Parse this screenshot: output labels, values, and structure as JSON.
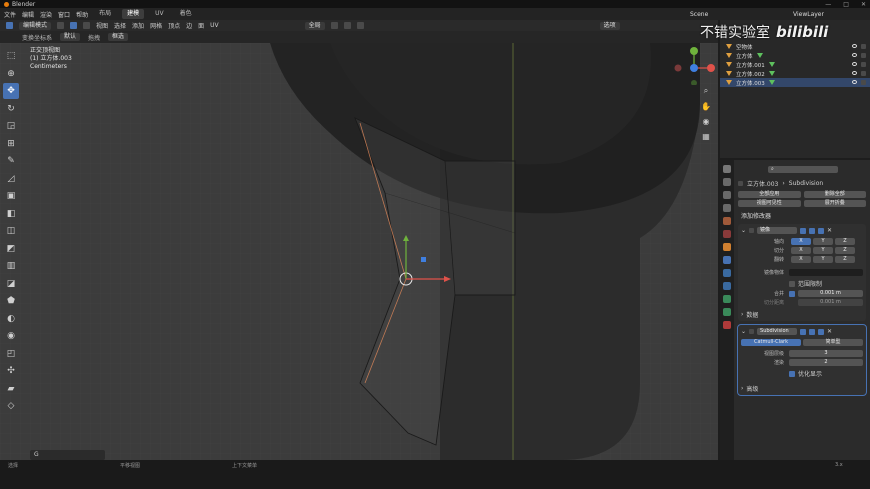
{
  "titlebar": {
    "title": "Blender",
    "controls": [
      "—",
      "□",
      "✕"
    ]
  },
  "menubar": {
    "menus": [
      "文件",
      "编辑",
      "渲染",
      "窗口",
      "帮助"
    ],
    "tabs": [
      "布局",
      "建模",
      "UV",
      "着色"
    ],
    "active_tab": "建模",
    "scene_label": "Scene",
    "viewlayer_label": "ViewLayer"
  },
  "header": {
    "mode": "编辑模式",
    "menus": [
      "视图",
      "选择",
      "添加",
      "网格",
      "顶点",
      "边",
      "面",
      "UV"
    ],
    "transform_orient": "全局",
    "tool_options": [
      "选项"
    ]
  },
  "tooloptions": {
    "orient_label": "变换坐标系",
    "orient_value": "默认",
    "drag_label": "拖拽",
    "drag_value": "框选"
  },
  "viewport": {
    "view_name": "正交顶视图",
    "object_name": "(1) 立方体.003",
    "units": "Centimeters",
    "search_text": "G"
  },
  "outliner": {
    "items": [
      {
        "name": "空物体",
        "selected": false
      },
      {
        "name": "立方体",
        "selected": false
      },
      {
        "name": "立方体.001",
        "selected": false
      },
      {
        "name": "立方体.002",
        "selected": false
      },
      {
        "name": "立方体.003",
        "selected": true
      }
    ]
  },
  "properties": {
    "object_name": "立方体.003",
    "modifier_name": "Subdivision",
    "apply_all": "全部应用",
    "delete_all": "删除全部",
    "viewport_vis": "视图可见性",
    "expand_all": "展开折叠",
    "add_modifier": "添加修改器",
    "mirror": {
      "name": "镜像",
      "axis_label": "轴向",
      "bisect_label": "切分",
      "flip_label": "翻转",
      "axes": [
        "X",
        "Y",
        "Z"
      ],
      "mirror_object": "镜像物体",
      "clipping": "范围限制",
      "merge_label": "合并",
      "merge_value": "0.001 m",
      "bisect_dist_label": "切分距离",
      "bisect_dist_value": "0.001 m",
      "data_label": "数据"
    },
    "subdivision": {
      "name": "Subdivision",
      "type_cc": "Catmull-Clark",
      "type_simple": "简单型",
      "levels_label": "视图层级",
      "levels_value": "3",
      "render_label": "渲染",
      "render_value": "2",
      "optimal_label": "优化显示",
      "advanced_label": "高级"
    }
  },
  "statusbar": {
    "items": [
      "选择",
      "平移视图",
      "上下文菜单"
    ],
    "version": "3.x"
  },
  "watermark": {
    "text": "不错实验室",
    "logo": "bilibili"
  },
  "icons": [
    "cursor-icon",
    "move-icon",
    "rotate-icon",
    "scale-icon",
    "transform-icon",
    "annotate-icon",
    "measure-icon",
    "add-cube-icon",
    "extrude-icon",
    "inset-icon",
    "bevel-icon",
    "loopcut-icon",
    "knife-icon",
    "polybuild-icon",
    "spin-icon",
    "smooth-icon",
    "edge-slide-icon",
    "shrink-icon",
    "shear-icon",
    "rip-icon"
  ],
  "colors": {
    "accent": "#4772b3",
    "blender_orange": "#e87d0d",
    "x_axis": "#e0524a",
    "y_axis": "#6fb33c",
    "z_axis": "#3f7fe0"
  }
}
